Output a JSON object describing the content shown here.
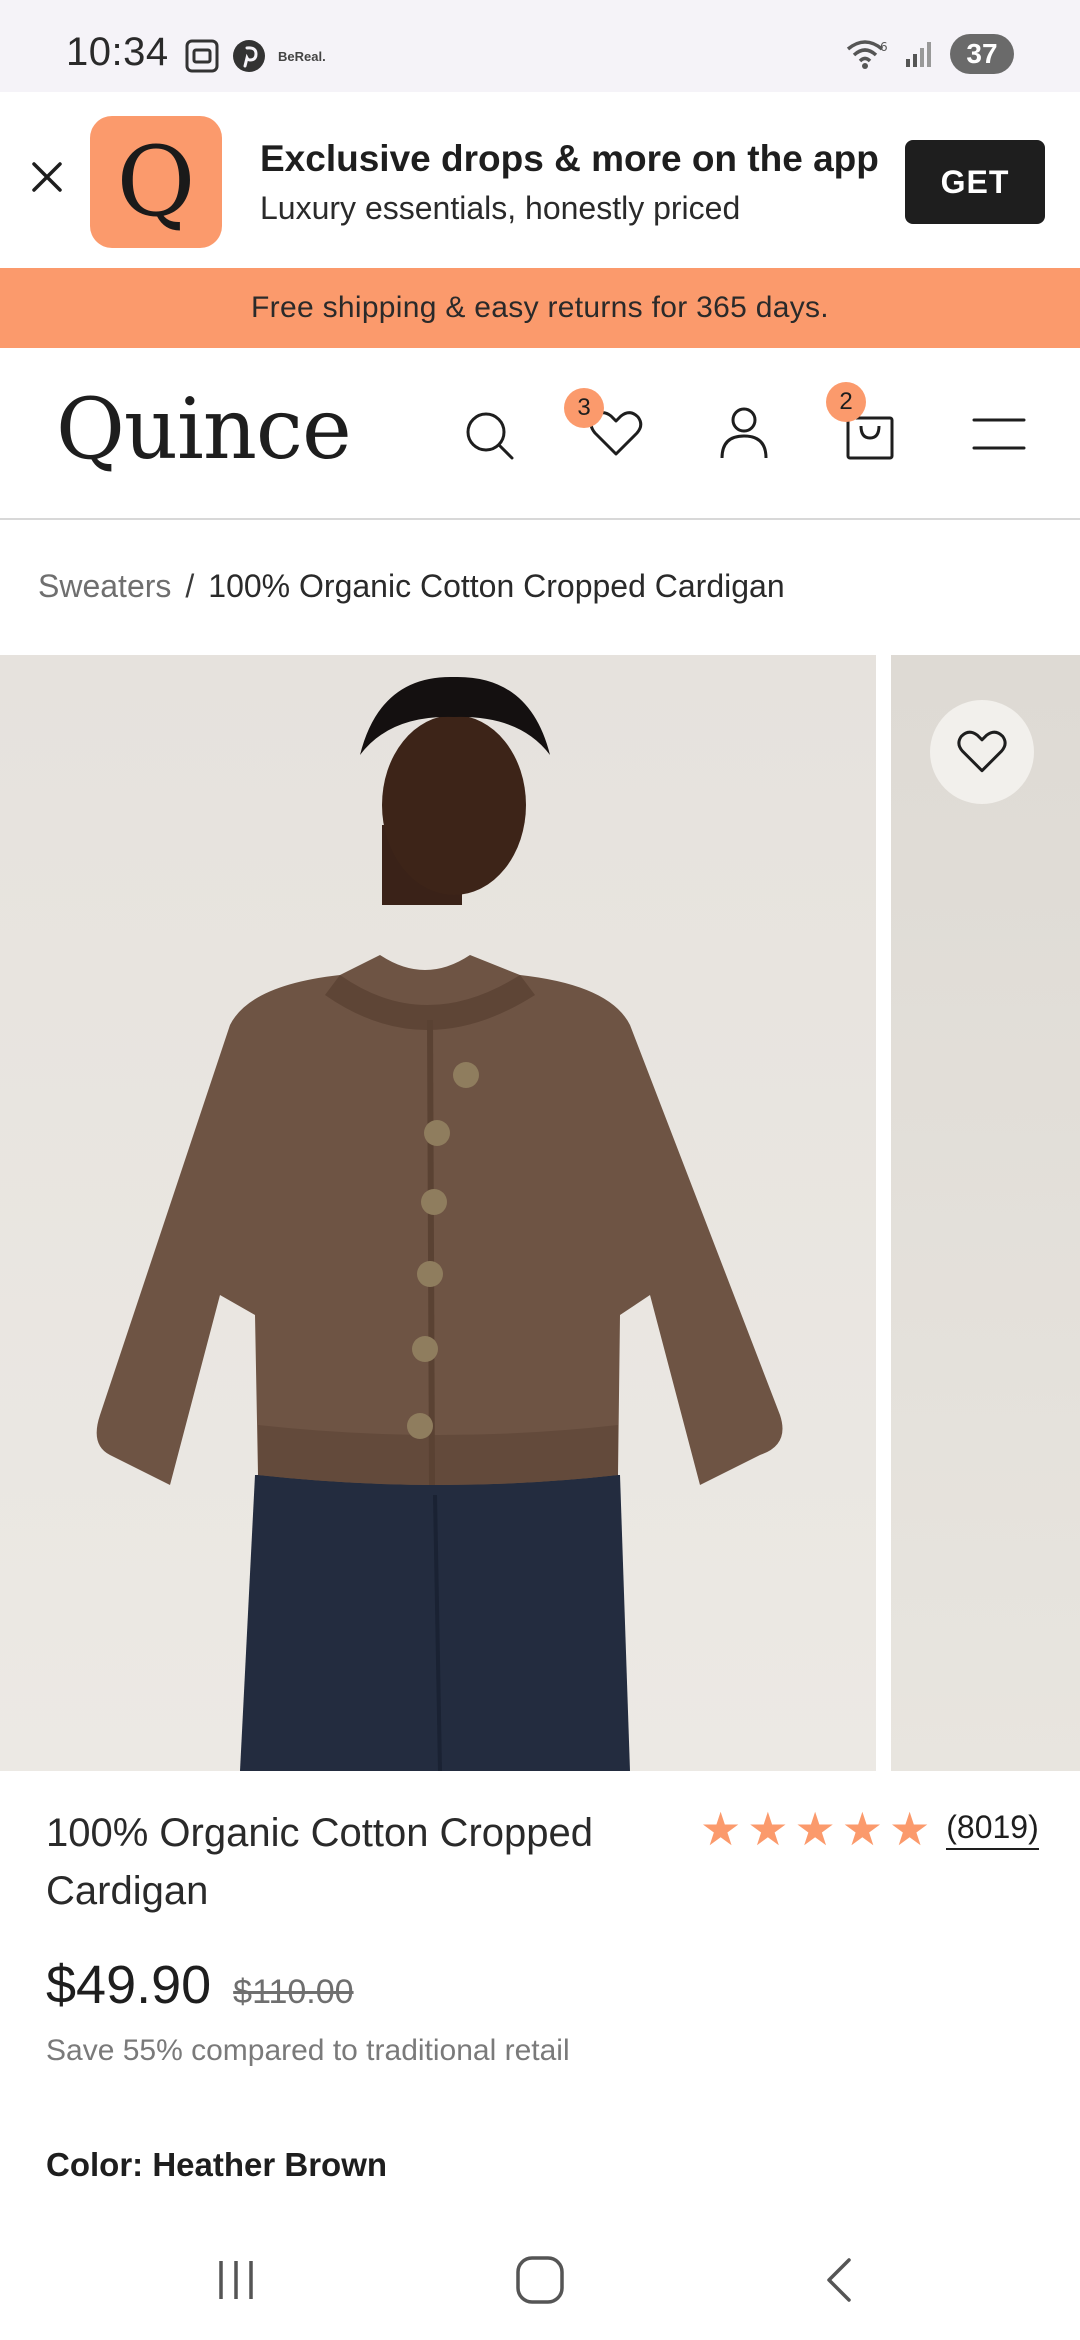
{
  "status_bar": {
    "time": "10:34",
    "app_label": "BeReal.",
    "wifi_label": "6",
    "battery": "37"
  },
  "app_banner": {
    "logo_letter": "Q",
    "title": "Exclusive drops & more on the app",
    "subtitle": "Luxury essentials, honestly priced",
    "get_label": "GET",
    "logo_color": "#fb9a6c"
  },
  "promo": {
    "text": "Free shipping & easy returns for 365 days."
  },
  "header": {
    "logo": "Quince",
    "wishlist_count": "3",
    "cart_count": "2",
    "icons": [
      "search-icon",
      "heart-icon",
      "account-icon",
      "bag-icon",
      "menu-icon"
    ]
  },
  "breadcrumb": {
    "parent": "Sweaters",
    "separator": "/",
    "current": "100% Organic Cotton Cropped Cardigan"
  },
  "product": {
    "title": "100% Organic Cotton Cropped Cardigan",
    "rating": 5,
    "stars": [
      "★",
      "★",
      "★",
      "★",
      "★"
    ],
    "review_count": "(8019)",
    "price": "$49.90",
    "original_price": "$110.00",
    "save_note": "Save 55% compared to traditional retail",
    "color_label": "Color: Heather Brown"
  },
  "colors": {
    "accent": "#fb9a6c",
    "dark": "#1e1e1e"
  }
}
